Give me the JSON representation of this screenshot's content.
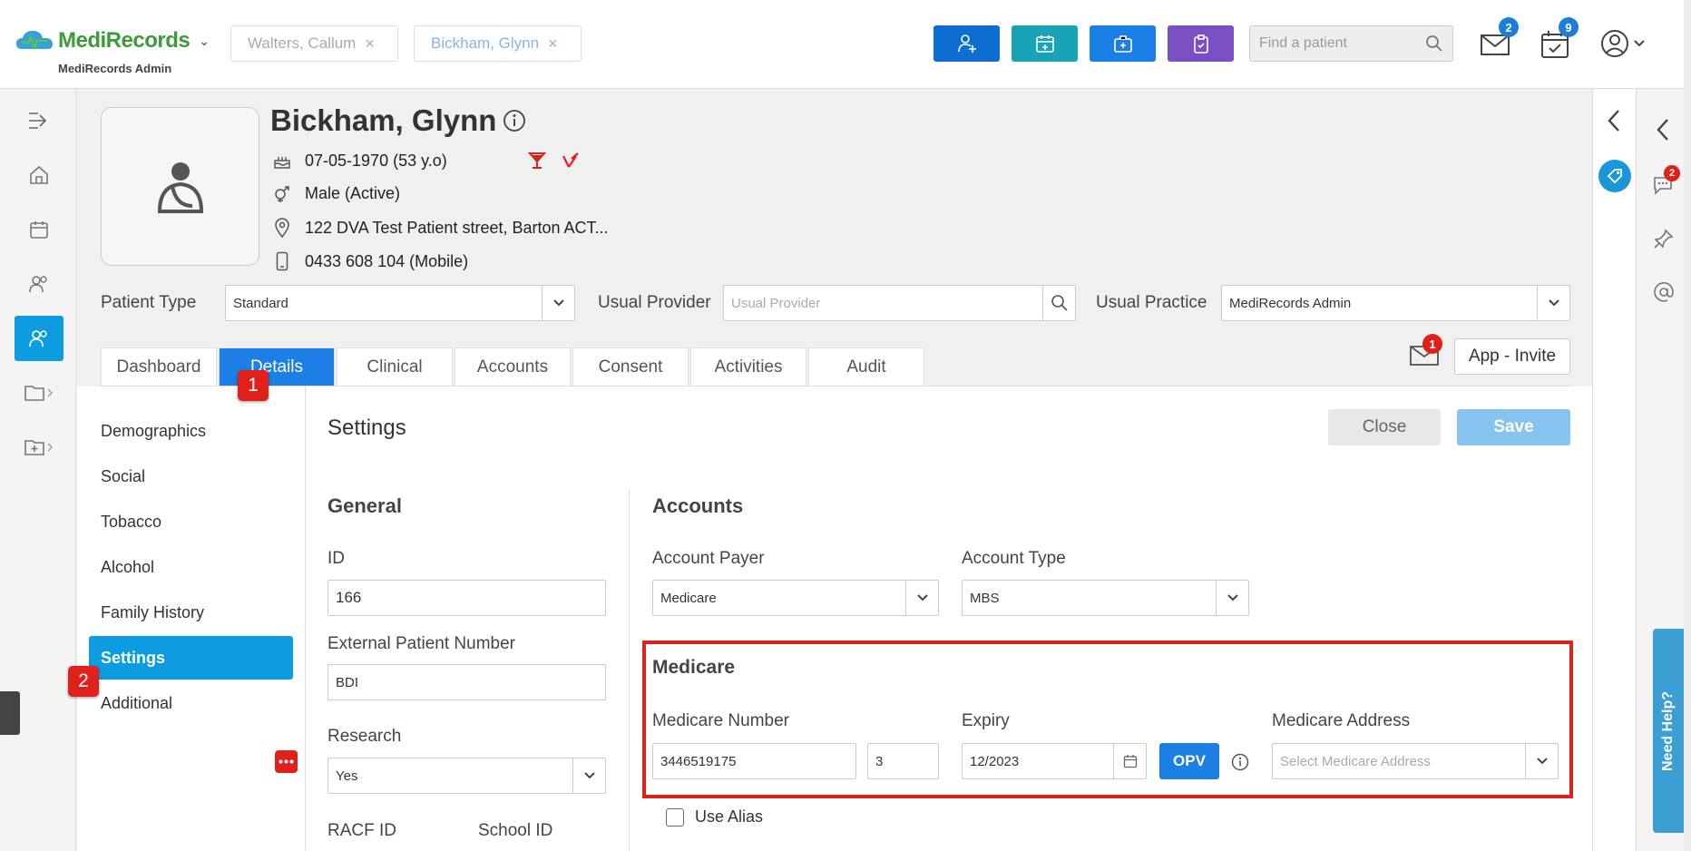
{
  "app": {
    "brand_part1": "Medi",
    "brand_part2": "Records",
    "subtitle": "MediRecords Admin"
  },
  "patient_tabs": [
    {
      "label": "Walters, Callum"
    },
    {
      "label": "Bickham, Glynn"
    }
  ],
  "search": {
    "placeholder": "Find a patient"
  },
  "notifications": {
    "mail_count": "2",
    "tasks_count": "9"
  },
  "colors": {
    "primary": "#1b7fe5",
    "teal": "#1aa3b6",
    "purple": "#7a4fc4",
    "dark_blue": "#0d6ecf",
    "active_nav": "#0d9ce0",
    "highlight": "#e0201b"
  },
  "patient": {
    "name": "Bickham, Glynn",
    "dob": "07-05-1970 (53 y.o)",
    "gender": "Male (Active)",
    "address": "122 DVA Test Patient street, Barton ACT...",
    "phone": "0433 608 104 (Mobile)"
  },
  "fields": {
    "patient_type_label": "Patient Type",
    "patient_type_value": "Standard",
    "usual_provider_label": "Usual Provider",
    "usual_provider_placeholder": "Usual Provider",
    "usual_practice_label": "Usual Practice",
    "usual_practice_value": "MediRecords Admin"
  },
  "tabs": [
    "Dashboard",
    "Details",
    "Clinical",
    "Accounts",
    "Consent",
    "Activities",
    "Audit"
  ],
  "header_actions": {
    "invite_badge": "1",
    "app_invite": "App - Invite"
  },
  "step_badges": {
    "one": "1",
    "two": "2"
  },
  "subnav": [
    "Demographics",
    "Social",
    "Tobacco",
    "Alcohol",
    "Family History",
    "Settings",
    "Additional"
  ],
  "settings": {
    "title": "Settings",
    "close": "Close",
    "save": "Save",
    "general_title": "General",
    "id_label": "ID",
    "id_value": "166",
    "ext_label": "External Patient Number",
    "ext_value": "BDI",
    "research_label": "Research",
    "research_value": "Yes",
    "racf_label": "RACF ID",
    "school_label": "School ID",
    "accounts_title": "Accounts",
    "payer_label": "Account Payer",
    "payer_value": "Medicare",
    "type_label": "Account Type",
    "type_value": "MBS",
    "medicare_title": "Medicare",
    "medicare_number_label": "Medicare Number",
    "medicare_number": "3446519175",
    "medicare_irn": "3",
    "expiry_label": "Expiry",
    "expiry_value": "12/2023",
    "opv": "OPV",
    "address_label": "Medicare Address",
    "address_placeholder": "Select Medicare Address",
    "use_alias": "Use Alias"
  },
  "right_panel": {
    "chat_badge": "2",
    "need_help": "Need Help?"
  }
}
